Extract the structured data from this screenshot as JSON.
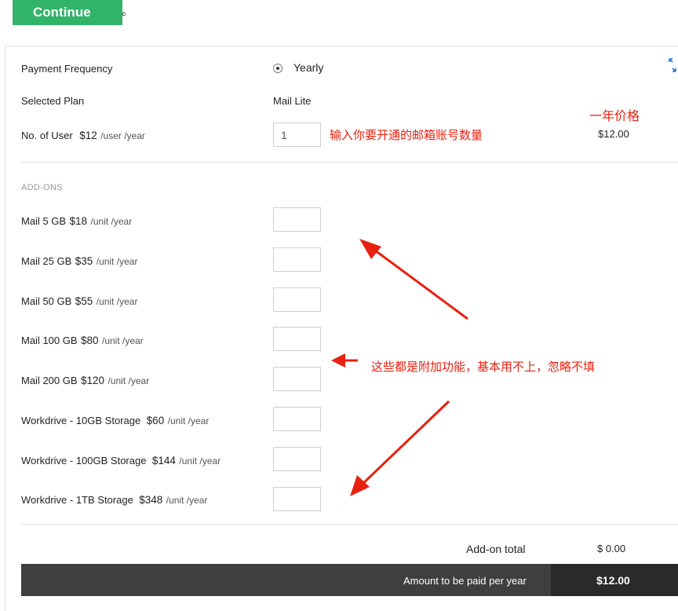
{
  "topbar": {
    "continue_label": "Continue",
    "period": "。"
  },
  "plan": {
    "frequency_label": "Payment Frequency",
    "frequency_option": "Yearly",
    "frequency_selected": true,
    "selected_plan_label": "Selected Plan",
    "selected_plan_value": "Mail Lite",
    "users_label": "No. of User",
    "users_price": "$12",
    "users_unit": "/user /year",
    "users_value": "1",
    "users_line_total": "$12.00"
  },
  "addons": {
    "heading": "ADD-ONS",
    "items": [
      {
        "name": "Mail 5 GB",
        "price": "$18",
        "unit": "/unit /year",
        "value": ""
      },
      {
        "name": "Mail 25 GB",
        "price": "$35",
        "unit": "/unit /year",
        "value": ""
      },
      {
        "name": "Mail 50 GB",
        "price": "$55",
        "unit": "/unit /year",
        "value": ""
      },
      {
        "name": "Mail 100 GB",
        "price": "$80",
        "unit": "/unit /year",
        "value": ""
      },
      {
        "name": "Mail 200 GB",
        "price": "$120",
        "unit": "/unit /year",
        "value": ""
      },
      {
        "name": "Workdrive - 10GB Storage",
        "price": "$60",
        "unit": "/unit /year",
        "value": ""
      },
      {
        "name": "Workdrive - 100GB Storage",
        "price": "$144",
        "unit": "/unit /year",
        "value": ""
      },
      {
        "name": "Workdrive - 1TB Storage",
        "price": "$348",
        "unit": "/unit /year",
        "value": ""
      }
    ]
  },
  "totals": {
    "addon_total_label": "Add-on total",
    "addon_total_value": "$ 0.00",
    "amount_label": "Amount to be paid per year",
    "amount_value": "$12.00"
  },
  "annotations": {
    "yearly_price": "一年价格",
    "enter_users": "输入你要开通的邮箱账号数量",
    "addons_note": "这些都是附加功能，基本用不上，忽略不填"
  },
  "colors": {
    "button_green": "#31b46a",
    "annotation_red": "#e8200f",
    "footer_dark": "#3f3f3f",
    "footer_darker": "#2a2a2a",
    "expand_icon_blue": "#1a73e8"
  }
}
